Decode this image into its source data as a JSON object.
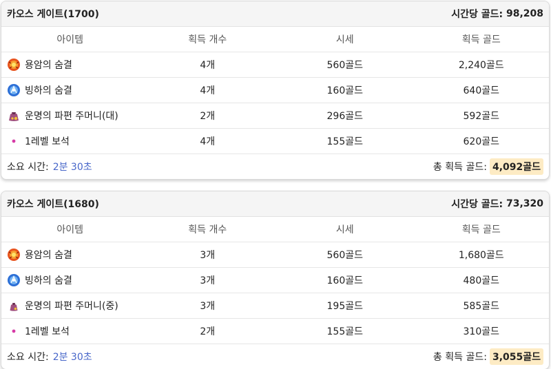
{
  "cards": [
    {
      "title": "카오스 게이트(1700)",
      "gold_per_hour_label": "시간당 골드:",
      "gold_per_hour_value": "98,208",
      "columns": [
        "아이템",
        "획득 개수",
        "시세",
        "획득 골드"
      ],
      "rows": [
        {
          "icon": "lava-breath-icon",
          "name": "용암의 숨결",
          "count": "4개",
          "price": "560골드",
          "gold": "2,240골드"
        },
        {
          "icon": "glacier-breath-icon",
          "name": "빙하의 숨결",
          "count": "4개",
          "price": "160골드",
          "gold": "640골드"
        },
        {
          "icon": "fate-pouch-icon",
          "name": "운명의 파편 주머니(대)",
          "count": "2개",
          "price": "296골드",
          "gold": "592골드"
        },
        {
          "icon": "gem-dot-icon",
          "name": "1레벨 보석",
          "count": "4개",
          "price": "155골드",
          "gold": "620골드"
        }
      ],
      "duration_label": "소요 시간:",
      "duration_value": "2분 30초",
      "total_label": "총 획득 골드:",
      "total_value": "4,092골드"
    },
    {
      "title": "카오스 게이트(1680)",
      "gold_per_hour_label": "시간당 골드:",
      "gold_per_hour_value": "73,320",
      "columns": [
        "아이템",
        "획득 개수",
        "시세",
        "획득 골드"
      ],
      "rows": [
        {
          "icon": "lava-breath-icon",
          "name": "용암의 숨결",
          "count": "3개",
          "price": "560골드",
          "gold": "1,680골드"
        },
        {
          "icon": "glacier-breath-icon",
          "name": "빙하의 숨결",
          "count": "3개",
          "price": "160골드",
          "gold": "480골드"
        },
        {
          "icon": "fate-pouch-icon",
          "name": "운명의 파편 주머니(중)",
          "count": "3개",
          "price": "195골드",
          "gold": "585골드"
        },
        {
          "icon": "gem-dot-icon",
          "name": "1레벨 보석",
          "count": "2개",
          "price": "155골드",
          "gold": "310골드"
        }
      ],
      "duration_label": "소요 시간:",
      "duration_value": "2분 30초",
      "total_label": "총 획득 골드:",
      "total_value": "3,055골드"
    }
  ],
  "colors": {
    "duration_link": "#4766c9",
    "total_highlight": "#fdebc4",
    "header_bg": "#f5f5f5"
  }
}
